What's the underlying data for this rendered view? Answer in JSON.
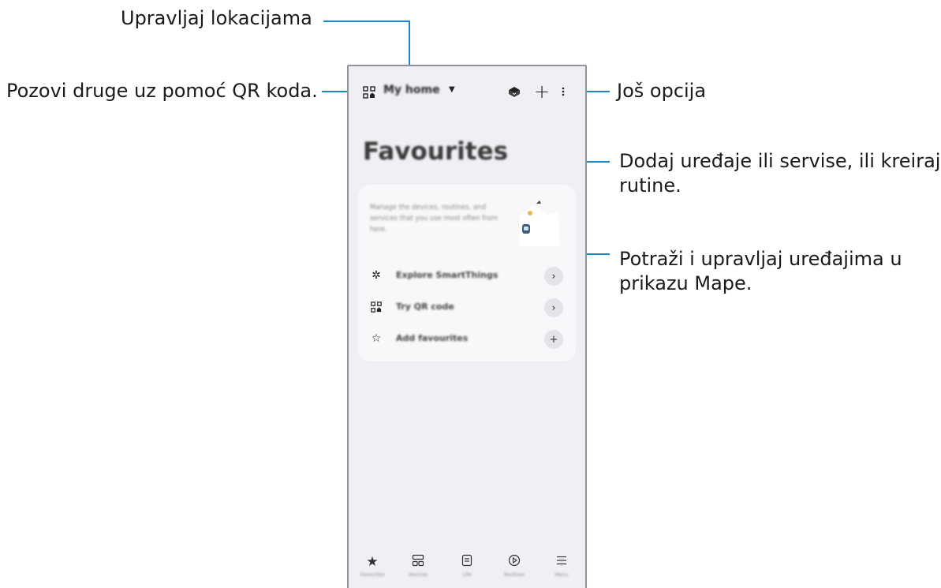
{
  "callouts": {
    "locations": "Upravljaj lokacijama",
    "qr_invite": "Pozovi druge uz pomoć QR koda.",
    "more_options": "Još opcija",
    "add_devices_line1": "Dodaj uređaje ili servise, ili kreiraj",
    "add_devices_line2": "rutine.",
    "map_view_line1": "Potraži i upravljaj uređajima u",
    "map_view_line2": "prikazu Mape."
  },
  "app": {
    "location_name": "My home",
    "page_title": "Favourites",
    "card": {
      "description": "Manage the devices, routines, and services that you use most often from here.",
      "rows": [
        {
          "label": "Explore SmartThings",
          "icon": "smartthings-icon",
          "action": "chevron-right-icon"
        },
        {
          "label": "Try QR code",
          "icon": "qr-code-icon",
          "action": "chevron-right-icon"
        },
        {
          "label": "Add favourites",
          "icon": "star-outline-icon",
          "action": "plus-icon"
        }
      ]
    },
    "nav": [
      {
        "label": "Favourites",
        "icon": "star-icon",
        "selected": true
      },
      {
        "label": "Devices",
        "icon": "devices-icon",
        "selected": false
      },
      {
        "label": "Life",
        "icon": "life-icon",
        "selected": false
      },
      {
        "label": "Routines",
        "icon": "play-circle-icon",
        "selected": false
      },
      {
        "label": "Menu",
        "icon": "menu-icon",
        "selected": false
      }
    ]
  },
  "colors": {
    "leader_line": "#1b86c4",
    "phone_background": "#eef0f4",
    "card_background": "#f7f8fa"
  }
}
